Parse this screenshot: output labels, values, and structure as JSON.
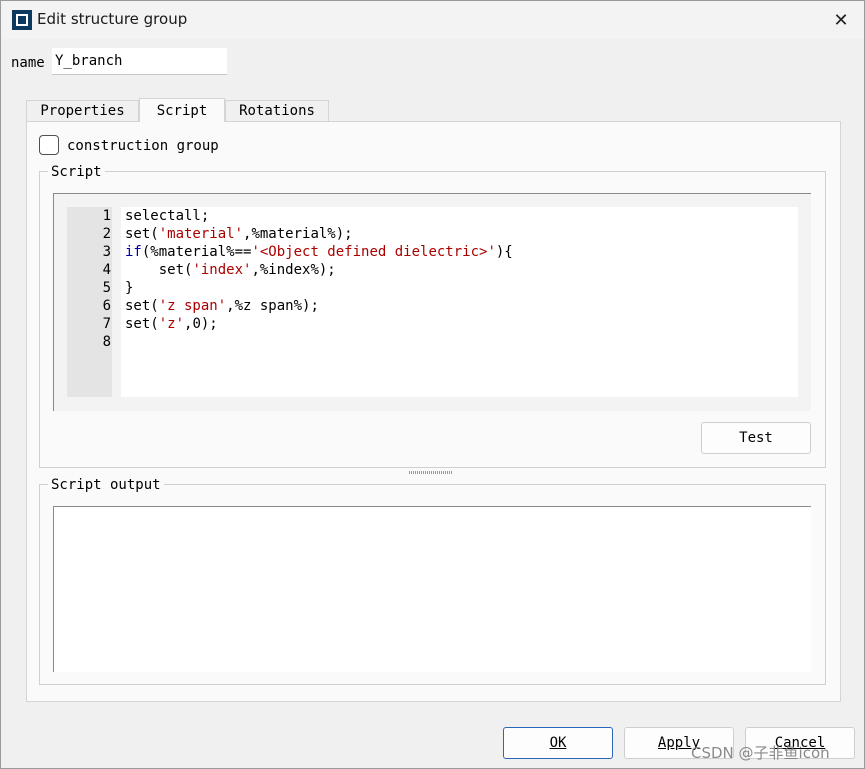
{
  "window": {
    "title": "Edit structure group",
    "close_glyph": "✕"
  },
  "name_field": {
    "label": "name",
    "value": "Y_branch"
  },
  "tabs": [
    {
      "label": "Properties",
      "active": false
    },
    {
      "label": "Script",
      "active": true
    },
    {
      "label": "Rotations",
      "active": false
    }
  ],
  "construction_group": {
    "label": "construction group",
    "checked": false
  },
  "script_group": {
    "title": "Script",
    "line_numbers": [
      "1",
      "2",
      "3",
      "4",
      "5",
      "6",
      "7",
      "8"
    ],
    "code_lines": [
      "selectall;",
      "set('material',%material%);",
      "if(%material%=='<Object defined dielectric>'){",
      "    set('index',%index%);",
      "}",
      "set('z span',%z span%);",
      "set('z',0);",
      ""
    ],
    "test_button": "Test"
  },
  "output_group": {
    "title": "Script output",
    "content": ""
  },
  "footer": {
    "ok": "OK",
    "apply": "Apply",
    "cancel": "Cancel"
  },
  "watermark": "CSDN @子非鱼icon",
  "colors": {
    "keyword": "#0000aa",
    "string": "#aa0000",
    "app_icon": "#0d3a5c"
  }
}
